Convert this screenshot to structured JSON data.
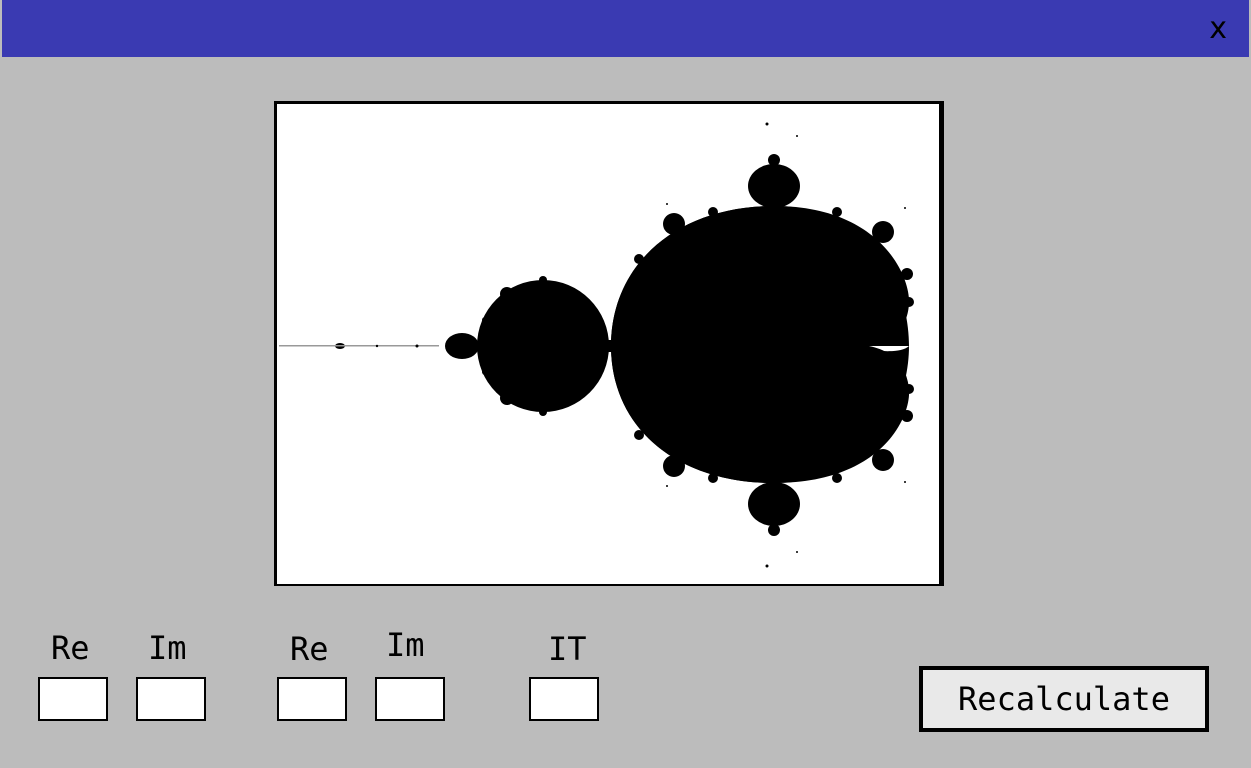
{
  "window": {
    "close_label": "x"
  },
  "viewer": {
    "image_label": "Mandelbrot set"
  },
  "fields": {
    "min_re_label": "Re",
    "min_im_label": "Im",
    "max_re_label": "Re",
    "max_im_label": "Im",
    "iterations_label": "IT",
    "min_re_value": "",
    "min_im_value": "",
    "max_re_value": "",
    "max_im_value": "",
    "iterations_value": ""
  },
  "actions": {
    "recalculate_label": "Recalculate"
  },
  "colors": {
    "titlebar": "#3a3ab2",
    "background": "#bcbcbc",
    "set": "#000000",
    "exterior": "#ffffff"
  }
}
